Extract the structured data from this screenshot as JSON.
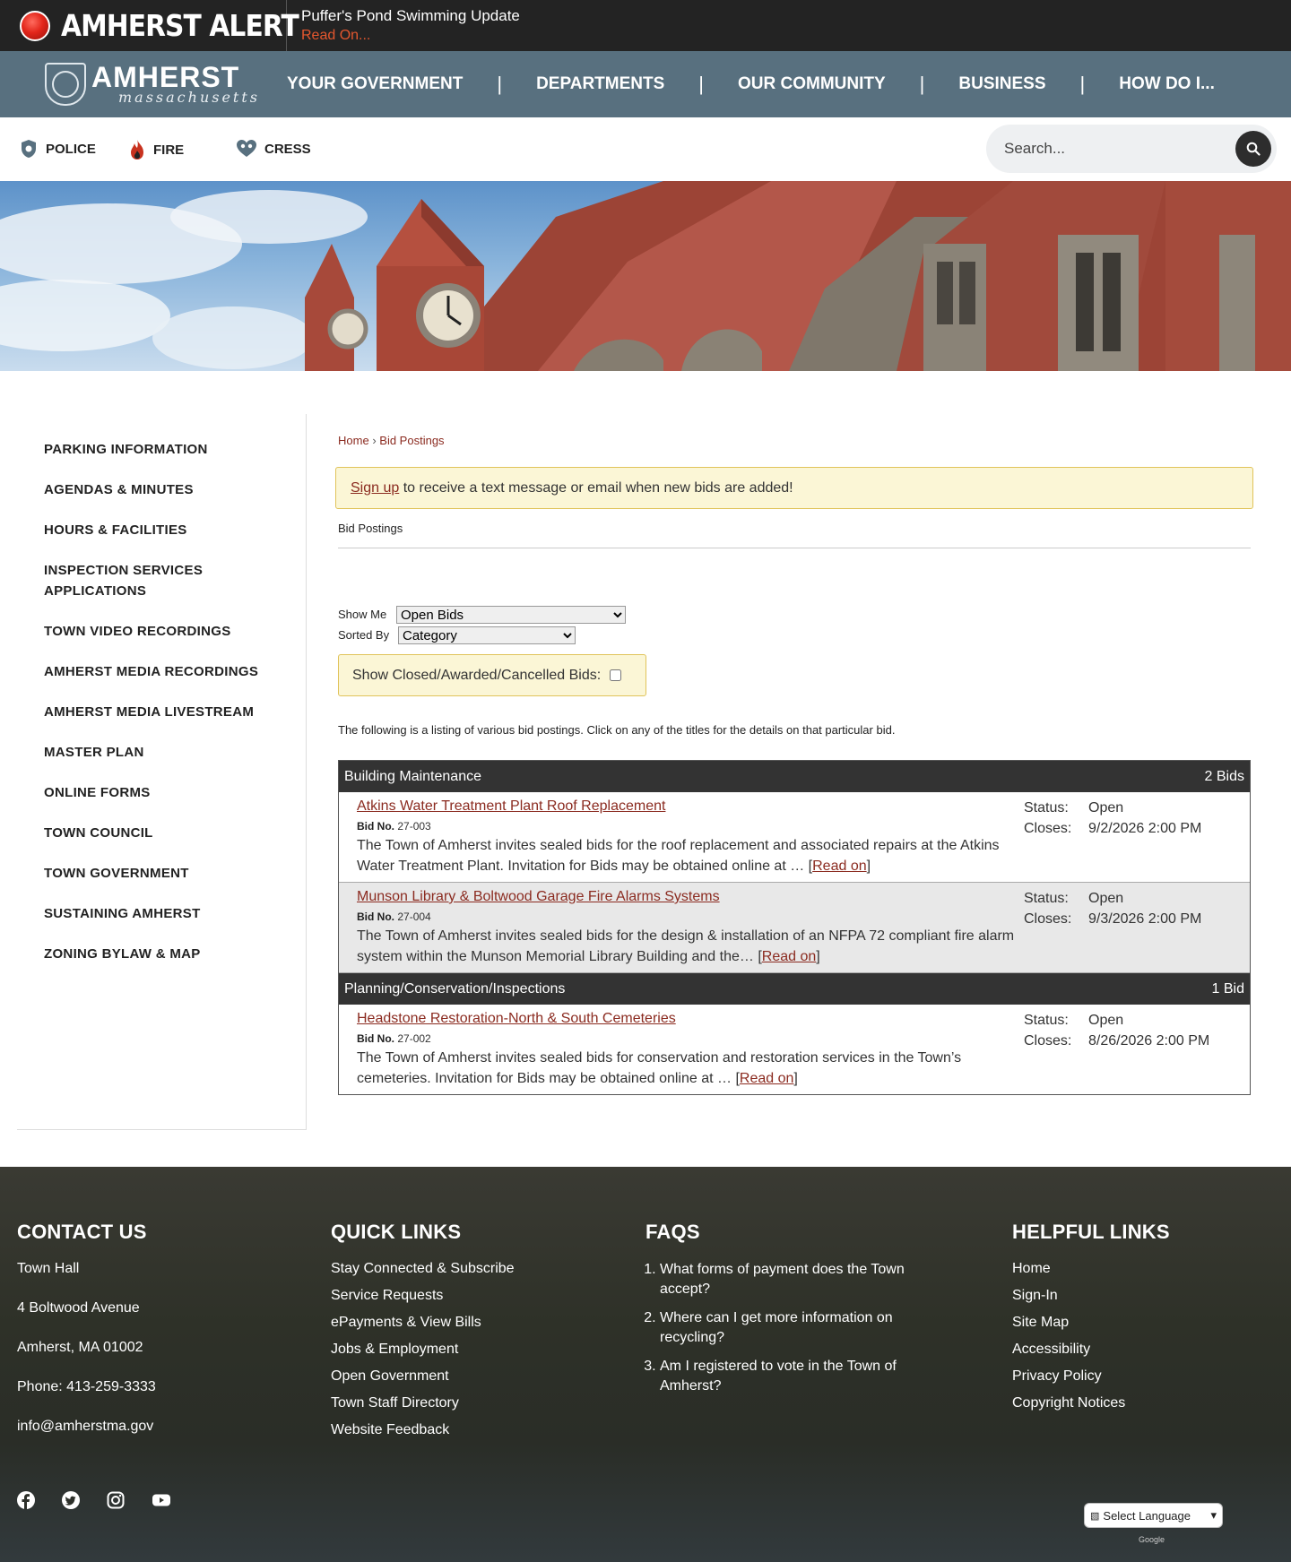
{
  "alert": {
    "brand": "AMHERST ALERT",
    "title": "Puffer's Pond Swimming Update",
    "read_on": "Read On..."
  },
  "logo": {
    "name": "AMHERST",
    "state": "massachusetts"
  },
  "nav": [
    "YOUR GOVERNMENT",
    "DEPARTMENTS",
    "OUR COMMUNITY",
    "BUSINESS",
    "HOW DO I..."
  ],
  "utility": {
    "police": "POLICE",
    "fire": "FIRE",
    "cress": "CRESS"
  },
  "search": {
    "placeholder": "Search..."
  },
  "sidebar": [
    "PARKING INFORMATION",
    "AGENDAS & MINUTES",
    "HOURS & FACILITIES",
    "INSPECTION SERVICES APPLICATIONS",
    "TOWN VIDEO RECORDINGS",
    "AMHERST MEDIA RECORDINGS",
    "AMHERST MEDIA LIVESTREAM",
    "MASTER PLAN",
    "ONLINE FORMS",
    "TOWN COUNCIL",
    "TOWN GOVERNMENT",
    "SUSTAINING AMHERST",
    "ZONING BYLAW & MAP"
  ],
  "breadcrumb": {
    "home": "Home",
    "sep": "›",
    "current": "Bid Postings"
  },
  "notice": {
    "link": "Sign up",
    "text": " to receive a text message or email when new bids are added!"
  },
  "page_title": "Bid Postings",
  "filters": {
    "show_me_label": "Show Me",
    "show_me_value": "Open Bids",
    "sorted_by_label": "Sorted By",
    "sorted_by_value": "Category",
    "closed_label": "Show Closed/Awarded/Cancelled Bids:"
  },
  "intro": "The following is a listing of various bid postings. Click on any of the titles for the details on that particular bid.",
  "categories": [
    {
      "name": "Building Maintenance",
      "count": "2 Bids",
      "bids": [
        {
          "title": "Atkins Water Treatment Plant Roof Replacement",
          "bid_no_label": "Bid No.",
          "bid_no": "27-003",
          "desc": "The Town of Amherst invites sealed bids for the roof replacement and associated repairs at the Atkins Water Treatment Plant. Invitation for Bids may be obtained online at … ",
          "read_on": "Read on",
          "status_label": "Status:",
          "status": "Open",
          "closes_label": "Closes:",
          "closes": "9/2/2026 2:00 PM"
        },
        {
          "title": "Munson Library & Boltwood Garage Fire Alarms Systems",
          "bid_no_label": "Bid No.",
          "bid_no": "27-004",
          "desc": "The Town of Amherst invites sealed bids for the design & installation of an NFPA 72 compliant fire alarm system within the Munson Memorial Library Building and the… ",
          "read_on": "Read on",
          "status_label": "Status:",
          "status": "Open",
          "closes_label": "Closes:",
          "closes": "9/3/2026 2:00 PM"
        }
      ]
    },
    {
      "name": "Planning/Conservation/Inspections",
      "count": "1 Bid",
      "bids": [
        {
          "title": "Headstone Restoration-North & South Cemeteries",
          "bid_no_label": "Bid No.",
          "bid_no": "27-002",
          "desc": "The Town of Amherst invites sealed bids for conservation and restoration services in the Town’s cemeteries. Invitation for Bids may be obtained online at … ",
          "read_on": "Read on",
          "status_label": "Status:",
          "status": "Open",
          "closes_label": "Closes:",
          "closes": "8/26/2026 2:00 PM"
        }
      ]
    }
  ],
  "footer": {
    "contact": {
      "heading": "CONTACT US",
      "lines": [
        "Town Hall",
        "4 Boltwood Avenue",
        "Amherst, MA 01002",
        "Phone: 413-259-3333",
        "info@amherstma.gov"
      ]
    },
    "quick": {
      "heading": "QUICK LINKS",
      "links": [
        "Stay Connected & Subscribe",
        "Service Requests",
        "ePayments & View Bills",
        "Jobs & Employment",
        "Open Government",
        "Town Staff Directory",
        "Website Feedback"
      ]
    },
    "faqs": {
      "heading": "FAQS",
      "items": [
        "What forms of payment does the Town accept?",
        "Where can I get more information on recycling?",
        "Am I registered to vote in the Town of Amherst?"
      ]
    },
    "helpful": {
      "heading": "HELPFUL LINKS",
      "links": [
        "Home",
        "Sign-In",
        "Site Map",
        "Accessibility",
        "Privacy Policy",
        "Copyright Notices"
      ]
    },
    "language": "Select Language",
    "powered": "Google"
  },
  "colors": {
    "nav": "#58707f",
    "accent_link": "#8b2b20",
    "alert_bg": "#232323",
    "notice_bg": "#fbf6d6"
  }
}
